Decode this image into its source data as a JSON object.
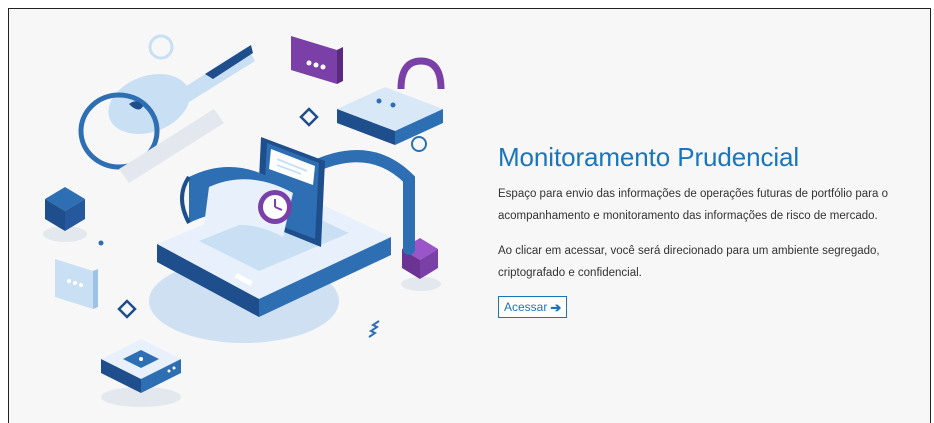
{
  "hero": {
    "title": "Monitoramento Prudencial",
    "paragraph_1": "Espaço para envio das informações de operações futuras de portfólio para o acompanhamento e monitoramento das informações de risco de mercado.",
    "paragraph_2": "Ao clicar em acessar, você será direcionado para um ambiente segregado, criptografado e confidencial.",
    "button_label": "Acessar",
    "button_icon": "arrow-right-icon"
  },
  "colors": {
    "accent": "#1b75bb",
    "dark_blue": "#1f4e8c",
    "purple": "#7b3fa8",
    "light_blue": "#c9dff3",
    "background": "#f7f7f7"
  }
}
